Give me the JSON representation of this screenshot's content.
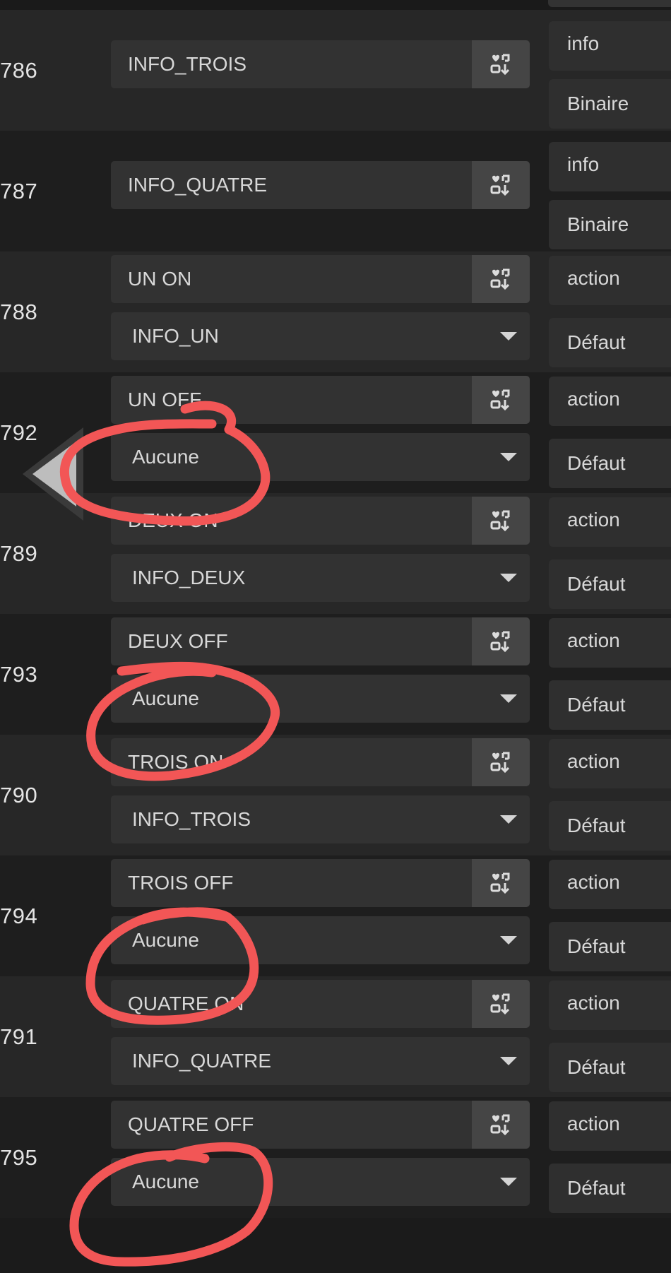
{
  "rows": [
    {
      "id": "786",
      "kind": "info",
      "name": "INFO_TROIS",
      "select": null,
      "type_label": "info",
      "sub_label": "Binaire"
    },
    {
      "id": "787",
      "kind": "info",
      "name": "INFO_QUATRE",
      "select": null,
      "type_label": "info",
      "sub_label": "Binaire"
    },
    {
      "id": "788",
      "kind": "action",
      "name": "UN ON",
      "select": "INFO_UN",
      "type_label": "action",
      "sub_label": "Défaut"
    },
    {
      "id": "792",
      "kind": "action",
      "name": "UN OFF",
      "select": "Aucune",
      "type_label": "action",
      "sub_label": "Défaut"
    },
    {
      "id": "789",
      "kind": "action",
      "name": "DEUX ON",
      "select": "INFO_DEUX",
      "type_label": "action",
      "sub_label": "Défaut"
    },
    {
      "id": "793",
      "kind": "action",
      "name": "DEUX OFF",
      "select": "Aucune",
      "type_label": "action",
      "sub_label": "Défaut"
    },
    {
      "id": "790",
      "kind": "action",
      "name": "TROIS ON",
      "select": "INFO_TROIS",
      "type_label": "action",
      "sub_label": "Défaut"
    },
    {
      "id": "794",
      "kind": "action",
      "name": "TROIS OFF",
      "select": "Aucune",
      "type_label": "action",
      "sub_label": "Défaut"
    },
    {
      "id": "791",
      "kind": "action",
      "name": "QUATRE ON",
      "select": "INFO_QUATRE",
      "type_label": "action",
      "sub_label": "Défaut"
    },
    {
      "id": "795",
      "kind": "action",
      "name": "QUATRE OFF",
      "select": "Aucune",
      "type_label": "action",
      "sub_label": "Défaut"
    }
  ],
  "icons": {
    "field_action": "configure-command-icon",
    "select_toggle": "caret-down-icon",
    "side_nav": "collapse-arrow-icon"
  },
  "colors": {
    "annotation": "#f25656",
    "field_bg": "#323232",
    "icon_button_bg": "#454545"
  }
}
